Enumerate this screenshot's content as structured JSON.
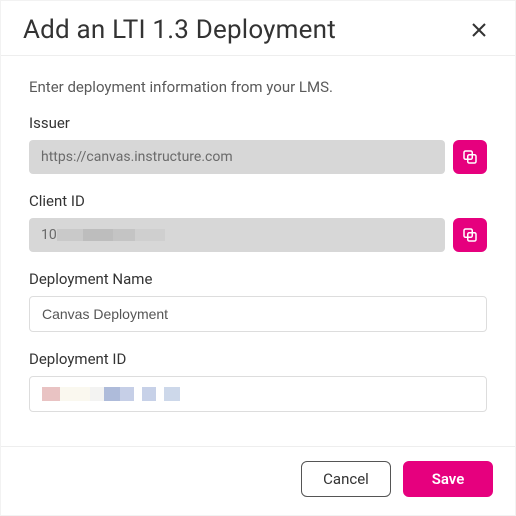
{
  "dialog": {
    "title": "Add an LTI 1.3 Deployment",
    "instruction": "Enter deployment information from your LMS."
  },
  "fields": {
    "issuer": {
      "label": "Issuer",
      "value": "https://canvas.instructure.com"
    },
    "client_id": {
      "label": "Client ID",
      "prefix": "10"
    },
    "deployment_name": {
      "label": "Deployment Name",
      "value": "Canvas Deployment"
    },
    "deployment_id": {
      "label": "Deployment ID",
      "value": ""
    }
  },
  "buttons": {
    "cancel": "Cancel",
    "save": "Save"
  },
  "colors": {
    "accent": "#e6007e"
  }
}
